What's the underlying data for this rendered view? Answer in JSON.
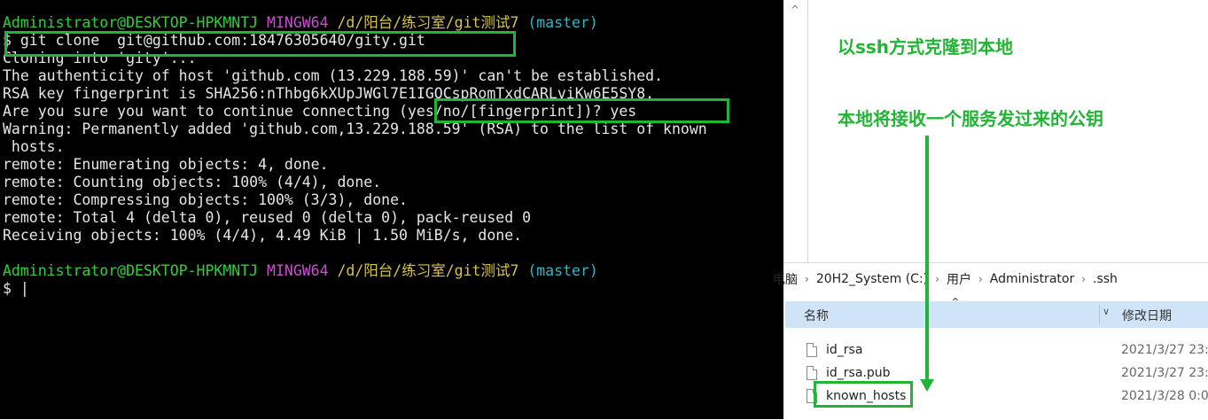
{
  "terminal": {
    "lines": [
      {
        "segments": [
          {
            "text": "Administrator@DESKTOP-HPKMNTJ ",
            "cls": "user"
          },
          {
            "text": "MINGW64 ",
            "cls": "mingw"
          },
          {
            "text": "/d/阳台/练习室/git测试7 ",
            "cls": "path"
          },
          {
            "text": "(master)",
            "cls": "branch"
          }
        ]
      },
      {
        "segments": [
          {
            "text": "$ git clone  git@github.com:18476305640/gity.git",
            "cls": ""
          }
        ]
      },
      {
        "segments": [
          {
            "text": "Cloning into 'gity'...",
            "cls": ""
          }
        ]
      },
      {
        "segments": [
          {
            "text": "The authenticity of host 'github.com (13.229.188.59)' can't be established.",
            "cls": ""
          }
        ]
      },
      {
        "segments": [
          {
            "text": "RSA key fingerprint is SHA256:nThbg6kXUpJWGl7E1IGOCspRomTxdCARLviKw6E5SY8.",
            "cls": ""
          }
        ]
      },
      {
        "segments": [
          {
            "text": "Are you sure you want to continue connecting (yes/no/[fingerprint])? yes",
            "cls": ""
          }
        ]
      },
      {
        "segments": [
          {
            "text": "Warning: Permanently added 'github.com,13.229.188.59' (RSA) to the list of known",
            "cls": ""
          }
        ]
      },
      {
        "segments": [
          {
            "text": " hosts.",
            "cls": ""
          }
        ]
      },
      {
        "segments": [
          {
            "text": "remote: Enumerating objects: 4, done.",
            "cls": ""
          }
        ]
      },
      {
        "segments": [
          {
            "text": "remote: Counting objects: 100% (4/4), done.",
            "cls": ""
          }
        ]
      },
      {
        "segments": [
          {
            "text": "remote: Compressing objects: 100% (3/3), done.",
            "cls": ""
          }
        ]
      },
      {
        "segments": [
          {
            "text": "remote: Total 4 (delta 0), reused 0 (delta 0), pack-reused 0",
            "cls": ""
          }
        ]
      },
      {
        "segments": [
          {
            "text": "Receiving objects: 100% (4/4), 4.49 KiB | 1.50 MiB/s, done.",
            "cls": ""
          }
        ]
      },
      {
        "segments": [
          {
            "text": "",
            "cls": ""
          }
        ]
      },
      {
        "segments": [
          {
            "text": "Administrator@DESKTOP-HPKMNTJ ",
            "cls": "user"
          },
          {
            "text": "MINGW64 ",
            "cls": "mingw"
          },
          {
            "text": "/d/阳台/练习室/git测试7 ",
            "cls": "path"
          },
          {
            "text": "(master)",
            "cls": "branch"
          }
        ]
      },
      {
        "segments": [
          {
            "text": "$ ",
            "cls": ""
          },
          {
            "text": "|",
            "cls": "cursor"
          }
        ]
      }
    ]
  },
  "annotations": {
    "clone_note": "以ssh方式克隆到本地",
    "key_note": "本地将接收一个服务发过来的公钥"
  },
  "explorer": {
    "breadcrumb": [
      "电脑",
      "20H2_System (C:)",
      "用户",
      "Administrator",
      ".ssh"
    ],
    "header_name": "名称",
    "header_date": "修改日期",
    "files": [
      {
        "name": "id_rsa",
        "date": "2021/3/27 23:"
      },
      {
        "name": "id_rsa.pub",
        "date": "2021/3/27 23:"
      },
      {
        "name": "known_hosts",
        "date": "2021/3/28 0:0"
      }
    ]
  },
  "colors": {
    "accent_green": "#22b535",
    "terminal_bg": "#000000",
    "header_bg": "#cfe4f7"
  }
}
